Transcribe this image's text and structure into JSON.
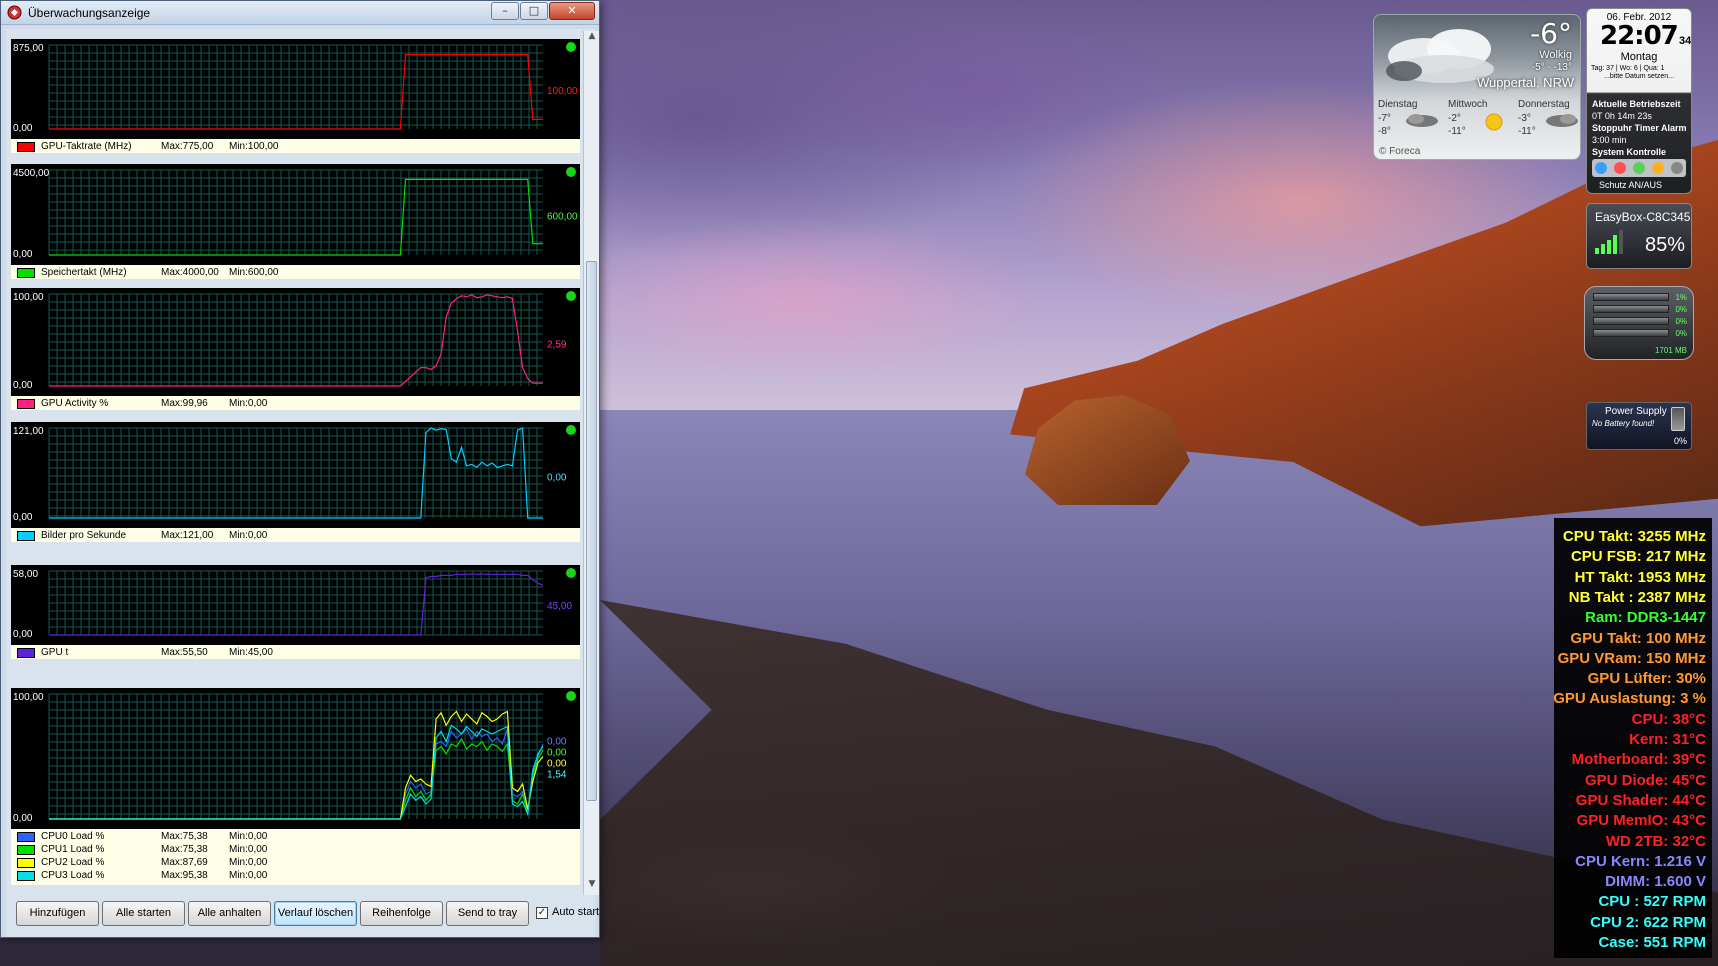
{
  "window": {
    "title": "Überwachungsanzeige",
    "buttons": {
      "minimize": "–",
      "maximize": "□",
      "close": "✕"
    }
  },
  "graphs": [
    {
      "ymax": "875,00",
      "ymin": "0,00",
      "current_labels": [
        {
          "text": "100,00",
          "color": "#ff2020"
        }
      ],
      "series": [
        {
          "name": "GPU-Taktrate (MHz)",
          "max": "Max:775,00",
          "min": "Min:100,00",
          "color": "#ff0000",
          "scale_max": 875,
          "values": [
            0,
            0,
            0,
            0,
            0,
            0,
            0,
            0,
            0,
            0,
            0,
            0,
            0,
            0,
            0,
            0,
            0,
            0,
            0,
            0,
            0,
            0,
            0,
            0,
            0,
            0,
            0,
            0,
            0,
            0,
            0,
            0,
            0,
            0,
            0,
            0,
            0,
            0,
            0,
            0,
            0,
            0,
            0,
            0,
            0,
            0,
            0,
            0,
            0,
            0,
            0,
            0,
            0,
            0,
            0,
            0,
            0,
            0,
            0,
            0,
            0,
            0,
            0,
            0,
            0,
            0,
            0,
            0,
            0,
            0,
            775,
            775,
            775,
            775,
            775,
            775,
            775,
            775,
            775,
            775,
            775,
            775,
            775,
            775,
            775,
            775,
            775,
            775,
            775,
            775,
            775,
            775,
            775,
            775,
            775,
            100,
            100,
            100
          ]
        }
      ]
    },
    {
      "ymax": "4500,00",
      "ymin": "0,00",
      "current_labels": [
        {
          "text": "600,00",
          "color": "#40ff40"
        }
      ],
      "series": [
        {
          "name": "Speichertakt (MHz)",
          "max": "Max:4000,00",
          "min": "Min:600,00",
          "color": "#00e000",
          "scale_max": 4500,
          "values": [
            0,
            0,
            0,
            0,
            0,
            0,
            0,
            0,
            0,
            0,
            0,
            0,
            0,
            0,
            0,
            0,
            0,
            0,
            0,
            0,
            0,
            0,
            0,
            0,
            0,
            0,
            0,
            0,
            0,
            0,
            0,
            0,
            0,
            0,
            0,
            0,
            0,
            0,
            0,
            0,
            0,
            0,
            0,
            0,
            0,
            0,
            0,
            0,
            0,
            0,
            0,
            0,
            0,
            0,
            0,
            0,
            0,
            0,
            0,
            0,
            0,
            0,
            0,
            0,
            0,
            0,
            0,
            0,
            0,
            0,
            4000,
            4000,
            4000,
            4000,
            4000,
            4000,
            4000,
            4000,
            4000,
            4000,
            4000,
            4000,
            4000,
            4000,
            4000,
            4000,
            4000,
            4000,
            4000,
            4000,
            4000,
            4000,
            4000,
            4000,
            4000,
            600,
            600,
            600
          ]
        }
      ]
    },
    {
      "ymax": "100,00",
      "ymin": "0,00",
      "current_labels": [
        {
          "text": "2,59",
          "color": "#ff3090"
        }
      ],
      "series": [
        {
          "name": "GPU Activity %",
          "max": "Max:99,96",
          "min": "Min:0,00",
          "color": "#ff2080",
          "scale_max": 100,
          "values": [
            0,
            0,
            0,
            0,
            0,
            0,
            0,
            0,
            0,
            0,
            0,
            0,
            0,
            0,
            0,
            0,
            0,
            0,
            0,
            0,
            0,
            0,
            0,
            0,
            0,
            0,
            0,
            0,
            0,
            0,
            0,
            0,
            0,
            0,
            0,
            0,
            0,
            0,
            0,
            0,
            0,
            0,
            0,
            0,
            0,
            0,
            0,
            0,
            0,
            0,
            0,
            0,
            0,
            0,
            0,
            0,
            0,
            0,
            0,
            0,
            0,
            0,
            0,
            0,
            0,
            0,
            0,
            0,
            0,
            0,
            5,
            10,
            15,
            20,
            20,
            18,
            22,
            35,
            75,
            90,
            95,
            98,
            97,
            99,
            96,
            97,
            99,
            98,
            97,
            96,
            97,
            95,
            60,
            20,
            8,
            3,
            3,
            3
          ]
        }
      ]
    },
    {
      "ymax": "121,00",
      "ymin": "0,00",
      "current_labels": [
        {
          "text": "0,00",
          "color": "#40e0ff"
        }
      ],
      "series": [
        {
          "name": "Bilder pro Sekunde",
          "max": "Max:121,00",
          "min": "Min:0,00",
          "color": "#00d0ff",
          "scale_max": 121,
          "values": [
            0,
            0,
            0,
            0,
            0,
            0,
            0,
            0,
            0,
            0,
            0,
            0,
            0,
            0,
            0,
            0,
            0,
            0,
            0,
            0,
            0,
            0,
            0,
            0,
            0,
            0,
            0,
            0,
            0,
            0,
            0,
            0,
            0,
            0,
            0,
            0,
            0,
            0,
            0,
            0,
            0,
            0,
            0,
            0,
            0,
            0,
            0,
            0,
            0,
            0,
            0,
            0,
            0,
            0,
            0,
            0,
            0,
            0,
            0,
            0,
            0,
            0,
            0,
            0,
            0,
            0,
            0,
            0,
            0,
            0,
            0,
            0,
            0,
            0,
            115,
            121,
            118,
            120,
            119,
            80,
            75,
            95,
            70,
            72,
            68,
            75,
            70,
            74,
            68,
            70,
            72,
            70,
            118,
            121,
            0,
            0,
            0,
            0
          ]
        }
      ]
    },
    {
      "ymax": "58,00",
      "ymin": "0,00",
      "current_labels": [
        {
          "text": "45,00",
          "color": "#8040ff"
        }
      ],
      "series": [
        {
          "name": "GPU t",
          "max": "Max:55,50",
          "min": "Min:45,00",
          "color": "#6020e0",
          "scale_max": 58,
          "values": [
            0,
            0,
            0,
            0,
            0,
            0,
            0,
            0,
            0,
            0,
            0,
            0,
            0,
            0,
            0,
            0,
            0,
            0,
            0,
            0,
            0,
            0,
            0,
            0,
            0,
            0,
            0,
            0,
            0,
            0,
            0,
            0,
            0,
            0,
            0,
            0,
            0,
            0,
            0,
            0,
            0,
            0,
            0,
            0,
            0,
            0,
            0,
            0,
            0,
            0,
            0,
            0,
            0,
            0,
            0,
            0,
            0,
            0,
            0,
            0,
            0,
            0,
            0,
            0,
            0,
            0,
            0,
            0,
            0,
            0,
            0,
            0,
            0,
            0,
            52,
            53,
            53,
            54,
            54,
            54,
            55,
            55,
            55,
            55.5,
            55,
            55.5,
            55,
            55,
            55,
            55,
            55,
            55,
            55,
            54,
            54,
            50,
            47,
            45
          ]
        }
      ]
    },
    {
      "ymax": "100,00",
      "ymin": "0,00",
      "current_labels": [
        {
          "text": "0,00",
          "color": "#6080ff"
        },
        {
          "text": "0,00",
          "color": "#40ff40"
        },
        {
          "text": "0,00",
          "color": "#ffff40"
        },
        {
          "text": "1,54",
          "color": "#40ffff"
        }
      ],
      "series": [
        {
          "name": "CPU0 Load %",
          "max": "Max:75,38",
          "min": "Min:0,00",
          "color": "#3060ff",
          "scale_max": 100,
          "values": [
            0,
            0,
            0,
            0,
            0,
            0,
            0,
            0,
            0,
            0,
            0,
            0,
            0,
            0,
            0,
            0,
            0,
            0,
            0,
            0,
            0,
            0,
            0,
            0,
            0,
            0,
            0,
            0,
            0,
            0,
            0,
            0,
            0,
            0,
            0,
            0,
            0,
            0,
            0,
            0,
            0,
            0,
            0,
            0,
            0,
            0,
            0,
            0,
            0,
            0,
            0,
            0,
            0,
            0,
            0,
            0,
            0,
            0,
            0,
            0,
            0,
            0,
            0,
            0,
            0,
            0,
            0,
            0,
            0,
            0,
            20,
            30,
            25,
            28,
            20,
            22,
            60,
            62,
            58,
            70,
            65,
            68,
            72,
            64,
            70,
            66,
            68,
            62,
            65,
            60,
            72,
            20,
            18,
            22,
            5,
            40,
            50,
            60
          ]
        },
        {
          "name": "CPU1 Load %",
          "max": "Max:75,38",
          "min": "Min:0,00",
          "color": "#00e000",
          "scale_max": 100,
          "values": [
            0,
            0,
            0,
            0,
            0,
            0,
            0,
            0,
            0,
            0,
            0,
            0,
            0,
            0,
            0,
            0,
            0,
            0,
            0,
            0,
            0,
            0,
            0,
            0,
            0,
            0,
            0,
            0,
            0,
            0,
            0,
            0,
            0,
            0,
            0,
            0,
            0,
            0,
            0,
            0,
            0,
            0,
            0,
            0,
            0,
            0,
            0,
            0,
            0,
            0,
            0,
            0,
            0,
            0,
            0,
            0,
            0,
            0,
            0,
            0,
            0,
            0,
            0,
            0,
            0,
            0,
            0,
            0,
            0,
            0,
            15,
            25,
            18,
            22,
            15,
            20,
            55,
            58,
            52,
            60,
            58,
            64,
            56,
            60,
            58,
            62,
            55,
            60,
            58,
            54,
            60,
            15,
            12,
            20,
            5,
            35,
            48,
            55
          ]
        },
        {
          "name": "CPU2 Load %",
          "max": "Max:87,69",
          "min": "Min:0,00",
          "color": "#ffff00",
          "scale_max": 100,
          "values": [
            0,
            0,
            0,
            0,
            0,
            0,
            0,
            0,
            0,
            0,
            0,
            0,
            0,
            0,
            0,
            0,
            0,
            0,
            0,
            0,
            0,
            0,
            0,
            0,
            0,
            0,
            0,
            0,
            0,
            0,
            0,
            0,
            0,
            0,
            0,
            0,
            0,
            0,
            0,
            0,
            0,
            0,
            0,
            0,
            0,
            0,
            0,
            0,
            0,
            0,
            0,
            0,
            0,
            0,
            0,
            0,
            0,
            0,
            0,
            0,
            0,
            0,
            0,
            0,
            0,
            0,
            0,
            0,
            0,
            0,
            25,
            35,
            30,
            32,
            28,
            26,
            80,
            85,
            75,
            82,
            86,
            78,
            84,
            80,
            76,
            85,
            82,
            78,
            80,
            84,
            86,
            25,
            22,
            28,
            8,
            30,
            45,
            50
          ]
        },
        {
          "name": "CPU3 Load %",
          "max": "Max:95,38",
          "min": "Min:0,00",
          "color": "#00e0e0",
          "scale_max": 100,
          "values": [
            0,
            0,
            0,
            0,
            0,
            0,
            0,
            0,
            0,
            0,
            0,
            0,
            0,
            0,
            0,
            0,
            0,
            0,
            0,
            0,
            0,
            0,
            0,
            0,
            0,
            0,
            0,
            0,
            0,
            0,
            0,
            0,
            0,
            0,
            0,
            0,
            0,
            0,
            0,
            0,
            0,
            0,
            0,
            0,
            0,
            0,
            0,
            0,
            0,
            0,
            0,
            0,
            0,
            0,
            0,
            0,
            0,
            0,
            0,
            0,
            0,
            0,
            0,
            0,
            0,
            0,
            0,
            0,
            0,
            0,
            10,
            20,
            15,
            18,
            12,
            16,
            65,
            70,
            62,
            75,
            72,
            68,
            74,
            70,
            66,
            72,
            70,
            68,
            70,
            72,
            74,
            12,
            10,
            14,
            4,
            38,
            52,
            58
          ]
        }
      ]
    }
  ],
  "bottom_buttons": [
    "Hinzufügen",
    "Alle starten",
    "Alle anhalten",
    "Verlauf löschen",
    "Reihenfolge",
    "Send to tray"
  ],
  "autostart": {
    "label": "Auto start",
    "checked": "✓"
  },
  "weather": {
    "temp": "-6°",
    "condition": "Wolkig",
    "range": "-5° - -13°",
    "location": "Wuppertal, NRW",
    "days": [
      {
        "name": "Dienstag",
        "hi": "-7°",
        "lo": "-8°"
      },
      {
        "name": "Mittwoch",
        "hi": "-2°",
        "lo": "-11°"
      },
      {
        "name": "Donnerstag",
        "hi": "-3°",
        "lo": "-11°"
      }
    ],
    "footer": "© Foreca"
  },
  "clock": {
    "date": "06. Febr. 2012",
    "time": "22:07",
    "seconds": "34",
    "weekday": "Montag",
    "info": "Tag: 37 | Wo: 6 | Qua: 1",
    "info2": "...bitte Datum setzen...",
    "uptime_label": "Aktuelle Betriebszeit",
    "uptime": "0T 0h 14m 23s",
    "tabs": "Stoppuhr Timer Alarm",
    "timer": "3:00 min",
    "sys_label": "System Kontrolle",
    "protect": "Schutz AN/AUS"
  },
  "wifi": {
    "name": "EasyBox-C8C345",
    "percent": "85%"
  },
  "meter": {
    "values": [
      "1%",
      "0%",
      "0%",
      "0%"
    ],
    "memory": "1701 MB"
  },
  "battery": {
    "title": "Power Supply",
    "note": "No Battery found!",
    "percent": "0%"
  },
  "sensors": [
    {
      "text": "CPU Takt: 3255 MHz",
      "color": "#ffff33"
    },
    {
      "text": "CPU FSB: 217 MHz",
      "color": "#ffff33"
    },
    {
      "text": "HT Takt: 1953 MHz",
      "color": "#ffff33"
    },
    {
      "text": "NB Takt : 2387 MHz",
      "color": "#ffff33"
    },
    {
      "text": "Ram: DDR3-1447",
      "color": "#33ff33"
    },
    {
      "text": "GPU Takt: 100 MHz",
      "color": "#ff9933"
    },
    {
      "text": "GPU VRam: 150 MHz",
      "color": "#ff9933"
    },
    {
      "text": "GPU Lüfter: 30%",
      "color": "#ff9933"
    },
    {
      "text": "GPU Auslastung: 3 %",
      "color": "#ff9933"
    },
    {
      "text": "CPU: 38°C",
      "color": "#ff2222"
    },
    {
      "text": "Kern: 31°C",
      "color": "#ff2222"
    },
    {
      "text": "Motherboard: 39°C",
      "color": "#ff2222"
    },
    {
      "text": "GPU Diode: 45°C",
      "color": "#ff2222"
    },
    {
      "text": "GPU Shader: 44°C",
      "color": "#ff2222"
    },
    {
      "text": "GPU MemIO: 43°C",
      "color": "#ff2222"
    },
    {
      "text": "WD 2TB: 32°C",
      "color": "#ff2222"
    },
    {
      "text": "CPU Kern: 1.216 V",
      "color": "#8888ff"
    },
    {
      "text": "DIMM: 1.600 V",
      "color": "#8888ff"
    },
    {
      "text": "CPU : 527 RPM",
      "color": "#33ffff"
    },
    {
      "text": "CPU 2: 622 RPM",
      "color": "#33ffff"
    },
    {
      "text": "Case: 551 RPM",
      "color": "#33ffff"
    }
  ]
}
